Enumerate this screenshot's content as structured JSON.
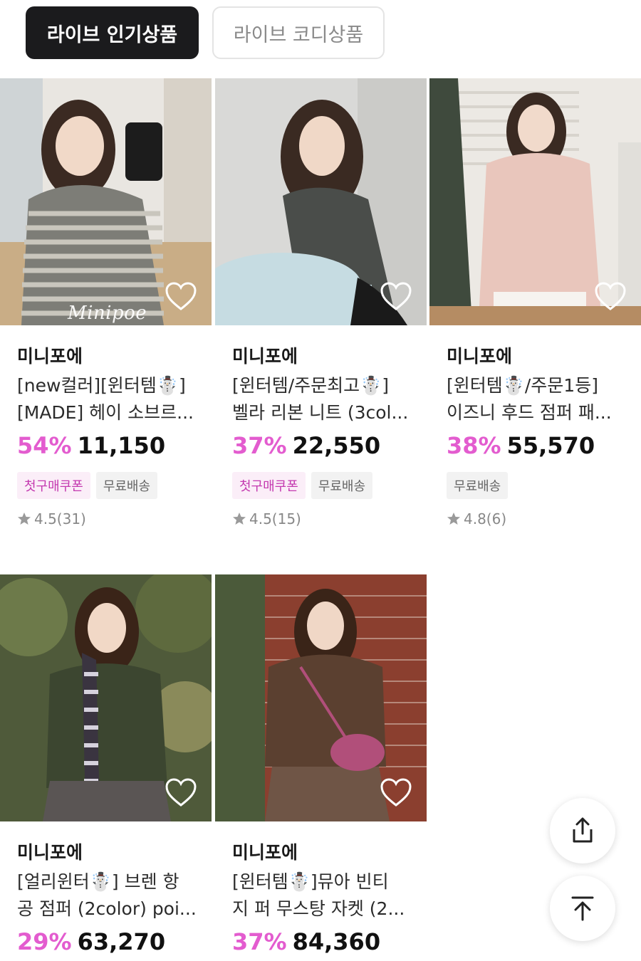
{
  "tabs": [
    {
      "label": "라이브 인기상품",
      "active": true
    },
    {
      "label": "라이브 코디상품",
      "active": false
    }
  ],
  "products": [
    {
      "brand": "미니포에",
      "title_line1": "[new컬러][윈터템☃️]",
      "title_line2": "[MADE] 헤이 소브르...",
      "discount": "54%",
      "price": "11,150",
      "badges": [
        "첫구매쿠폰",
        "무료배송"
      ],
      "rating": "4.5(31)",
      "watermark": "Minipoe"
    },
    {
      "brand": "미니포에",
      "title_line1": "[윈터템/주문최고☃️]",
      "title_line2": "벨라 리본 니트 (3col...",
      "discount": "37%",
      "price": "22,550",
      "badges": [
        "첫구매쿠폰",
        "무료배송"
      ],
      "rating": "4.5(15)"
    },
    {
      "brand": "미니포에",
      "title_line1": "[윈터템☃️/주문1등]",
      "title_line2": "이즈니 후드 점퍼 패...",
      "discount": "38%",
      "price": "55,570",
      "badges": [
        "무료배송"
      ],
      "rating": "4.8(6)"
    },
    {
      "brand": "미니포에",
      "title_line1": "[얼리윈터☃️] 브렌 항",
      "title_line2": "공 점퍼 (2color) poi...",
      "discount": "29%",
      "price": "63,270",
      "badges": [],
      "rating": ""
    },
    {
      "brand": "미니포에",
      "title_line1": "[윈터템☃️]뮤아 빈티",
      "title_line2": "지 퍼 무스탕 자켓 (2...",
      "discount": "37%",
      "price": "84,360",
      "badges": [],
      "rating": ""
    }
  ],
  "floating": {
    "share_icon": "share-icon",
    "top_icon": "scroll-to-top-icon"
  },
  "colors": {
    "discount": "#e35ccf",
    "active_tab_bg": "#1b1b1d",
    "coupon_bg": "#fbeef8",
    "coupon_text": "#c43ab0"
  }
}
